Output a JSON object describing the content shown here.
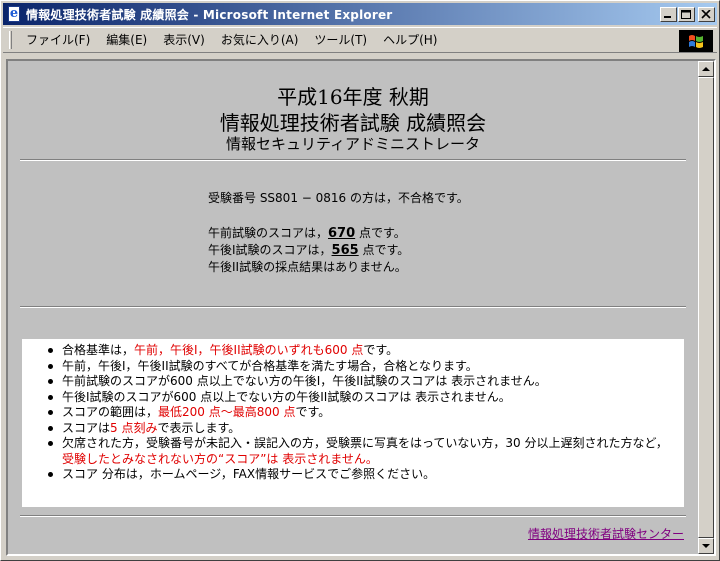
{
  "window": {
    "title": "情報処理技術者試験 成績照会 - Microsoft Internet Explorer"
  },
  "menu": [
    {
      "label": "ファイル(F)"
    },
    {
      "label": "編集(E)"
    },
    {
      "label": "表示(V)"
    },
    {
      "label": "お気に入り(A)"
    },
    {
      "label": "ツール(T)"
    },
    {
      "label": "ヘルプ(H)"
    }
  ],
  "page": {
    "heading1": "平成16年度 秋期",
    "heading2": "情報処理技術者試験 成績照会",
    "heading3": "情報セキュリティアドミニストレータ",
    "result_line": "受験番号 SS801 − 0816 の方は，不合格です。",
    "am_prefix": "午前試験のスコアは，",
    "am_score": "670",
    "am_suffix": " 点です。",
    "pm1_prefix": "午後I試験のスコアは，",
    "pm1_score": "565",
    "pm1_suffix": " 点です。",
    "pm2_line": "午後II試験の採点結果はありません。",
    "notes": {
      "n1_a": "合格基準は，",
      "n1_red": "午前，午後I，午後II試験のいずれも600 点",
      "n1_b": "です。",
      "n2": "午前，午後I，午後II試験のすべてが合格基準を満たす場合，合格となります。",
      "n3": "午前試験のスコアが600 点以上でない方の午後I，午後II試験のスコアは 表示されません。",
      "n4": "午後I試験のスコアが600 点以上でない方の午後II試験のスコアは 表示されません。",
      "n5_a": "スコアの範囲は，",
      "n5_red": "最低200 点〜最高800 点",
      "n5_b": "です。",
      "n6_a": "スコアは",
      "n6_red": "5 点刻み",
      "n6_b": "で表示します。",
      "n7_a": "欠席された方，受験番号が未記入・誤記入の方，受験票に写真をはっていない方，30 分以上遅刻された方など，",
      "n7_red": "受験したとみなされない方の“スコア”は 表示されません。",
      "n8": "スコア 分布は，ホームページ，FAX情報サービスでご参照ください。"
    },
    "footer_link": "情報処理技術者試験センター"
  },
  "colors": {
    "titlebar_start": "#0a246a",
    "titlebar_end": "#a6caf0",
    "emphasis_red": "#e00000",
    "visited_link": "#800080"
  },
  "icons": {
    "app": "ie-page-icon",
    "minimize": "minimize-icon",
    "maximize": "maximize-icon",
    "close": "close-icon",
    "brand": "windows-logo-icon"
  }
}
